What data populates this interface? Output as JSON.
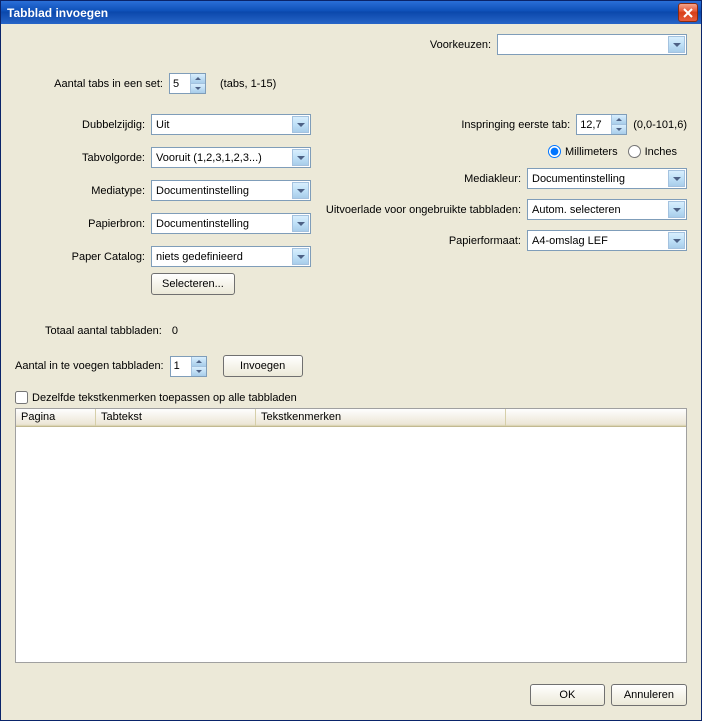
{
  "window": {
    "title": "Tabblad invoegen"
  },
  "presets": {
    "label": "Voorkeuzen:",
    "value": ""
  },
  "tabsInSet": {
    "label": "Aantal tabs in een set:",
    "value": "5",
    "hint": "(tabs, 1-15)"
  },
  "left": {
    "dubbelzijdig": {
      "label": "Dubbelzijdig:",
      "value": "Uit"
    },
    "tabvolgorde": {
      "label": "Tabvolgorde:",
      "value": "Vooruit (1,2,3,1,2,3...)"
    },
    "mediatype": {
      "label": "Mediatype:",
      "value": "Documentinstelling"
    },
    "papierbron": {
      "label": "Papierbron:",
      "value": "Documentinstelling"
    },
    "papercatalog": {
      "label": "Paper Catalog:",
      "value": "niets gedefinieerd",
      "selectBtn": "Selecteren..."
    }
  },
  "right": {
    "inspringing": {
      "label": "Inspringing eerste tab:",
      "value": "12,7",
      "hint": "(0,0-101,6)"
    },
    "units": {
      "mm": "Millimeters",
      "in": "Inches"
    },
    "mediakleur": {
      "label": "Mediakleur:",
      "value": "Documentinstelling"
    },
    "uitvoerlade": {
      "label": "Uitvoerlade voor ongebruikte tabbladen:",
      "value": "Autom. selecteren"
    },
    "papierformaat": {
      "label": "Papierformaat:",
      "value": "A4-omslag LEF"
    }
  },
  "totals": {
    "totalLabel": "Totaal aantal tabbladen:",
    "totalValue": "0",
    "insertCountLabel": "Aantal in te voegen tabbladen:",
    "insertCountValue": "1",
    "insertBtn": "Invoegen"
  },
  "applyAll": {
    "label": "Dezelfde tekstkenmerken toepassen op alle tabbladen"
  },
  "table": {
    "colPagina": "Pagina",
    "colTabtekst": "Tabtekst",
    "colTekstkenmerken": "Tekstkenmerken"
  },
  "buttons": {
    "ok": "OK",
    "cancel": "Annuleren"
  }
}
